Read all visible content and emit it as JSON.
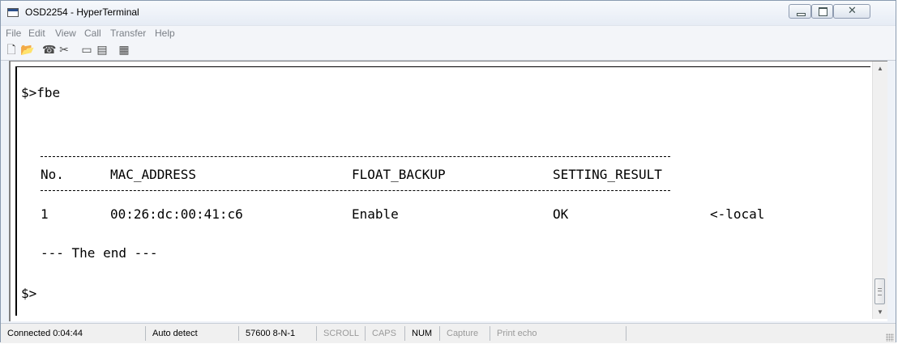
{
  "window": {
    "title": "OSD2254 - HyperTerminal",
    "controls": {
      "minimize": "minimize",
      "maximize": "maximize",
      "close": "close"
    }
  },
  "menu": [
    "File",
    "Edit",
    "View",
    "Call",
    "Transfer",
    "Help"
  ],
  "toolbar": [
    {
      "icon": "new-document-icon",
      "glyph": "🗋"
    },
    {
      "icon": "open-folder-icon",
      "glyph": "📂"
    },
    {
      "icon": "call-icon",
      "glyph": "☎"
    },
    {
      "icon": "disconnect-icon",
      "glyph": "✂"
    },
    {
      "icon": "send-icon",
      "glyph": "▭"
    },
    {
      "icon": "receive-icon",
      "glyph": "▤"
    },
    {
      "icon": "properties-icon",
      "glyph": "▦"
    }
  ],
  "terminal": {
    "command_line": "$>fbe",
    "table": {
      "headers": [
        "No.",
        "MAC_ADDRESS",
        "FLOAT_BACKUP",
        "SETTING_RESULT"
      ],
      "rows": [
        {
          "no": "1",
          "mac": "00:26:dc:00:41:c6",
          "float_backup": "Enable",
          "result": "OK",
          "note": "<-local"
        }
      ]
    },
    "end_marker": "--- The end ---",
    "prompt": "$>"
  },
  "status": {
    "connected": "Connected 0:04:44",
    "detect": "Auto detect",
    "baud": "57600 8-N-1",
    "scroll": "SCROLL",
    "caps": "CAPS",
    "num": "NUM",
    "capture": "Capture",
    "print_echo": "Print echo"
  },
  "colors": {
    "accent": "#2b4f8a",
    "terminal_bg": "#ffffff",
    "disabled_text": "#9a9a9a"
  }
}
